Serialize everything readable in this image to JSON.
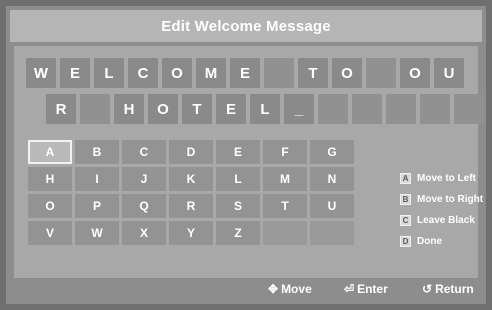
{
  "title": "Edit Welcome Message",
  "message": {
    "row1": [
      "W",
      "E",
      "L",
      "C",
      "O",
      "M",
      "E",
      "",
      "T",
      "O",
      "",
      "O",
      "U"
    ],
    "row2": [
      "R",
      "",
      "H",
      "O",
      "T",
      "E",
      "L",
      "_",
      "",
      "",
      "",
      "",
      ""
    ]
  },
  "keyboard": {
    "rows": [
      [
        "A",
        "B",
        "C",
        "D",
        "E",
        "F",
        "G"
      ],
      [
        "H",
        "I",
        "J",
        "K",
        "L",
        "M",
        "N"
      ],
      [
        "O",
        "P",
        "Q",
        "R",
        "S",
        "T",
        "U"
      ],
      [
        "V",
        "W",
        "X",
        "Y",
        "Z",
        "",
        ""
      ]
    ],
    "selected": "A"
  },
  "legend": [
    {
      "badge": "A",
      "label": "Move to Left"
    },
    {
      "badge": "B",
      "label": "Move to Right"
    },
    {
      "badge": "C",
      "label": "Leave Black"
    },
    {
      "badge": "D",
      "label": "Done"
    }
  ],
  "footer": {
    "move_label": "Move",
    "enter_label": "Enter",
    "return_label": "Return"
  },
  "colors": {
    "frame": "#8d8d8d",
    "title_bar": "#b5b5b5",
    "panel": "#a8a8a8",
    "cell": "#8a8a8a",
    "selected_key": "#b9b9b9"
  },
  "icons": {
    "move": "move-arrows-icon",
    "enter": "enter-icon",
    "return": "return-icon"
  }
}
